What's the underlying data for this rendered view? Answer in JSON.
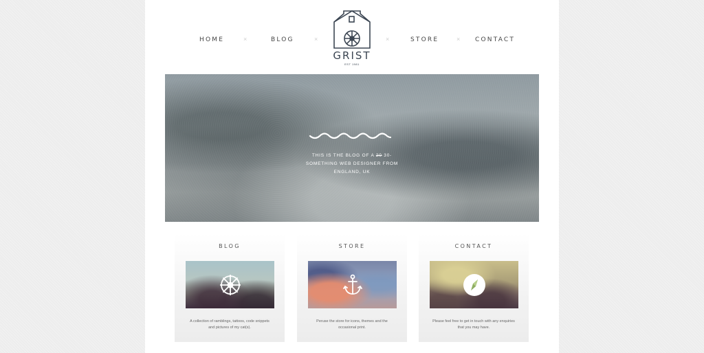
{
  "nav": {
    "home": "HOME",
    "blog": "BLOG",
    "store": "STORE",
    "contact": "CONTACT",
    "separator": "×"
  },
  "logo": {
    "name": "GRIST",
    "est": "EST 1981"
  },
  "hero": {
    "line_before": "THIS IS THE BLOG OF A ",
    "struck": "20",
    "line_after": " 30-SOMETHING WEB DESIGNER FROM ENGLAND, UK"
  },
  "cards": [
    {
      "title": "BLOG",
      "description": "A collection of ramblings, tattoos, code snippets and pictures of my cat(s).",
      "icon": "ship-wheel-icon"
    },
    {
      "title": "STORE",
      "description": "Peruse the store for icons, themes and the occasional print.",
      "icon": "anchor-icon"
    },
    {
      "title": "CONTACT",
      "description": "Please feel free to get in touch with any enquiries that you may have.",
      "icon": "compass-icon"
    }
  ],
  "colors": {
    "page_background": "#ededed",
    "content_background": "#ffffff",
    "logo": "#3b4552",
    "nav_text": "#444444"
  }
}
